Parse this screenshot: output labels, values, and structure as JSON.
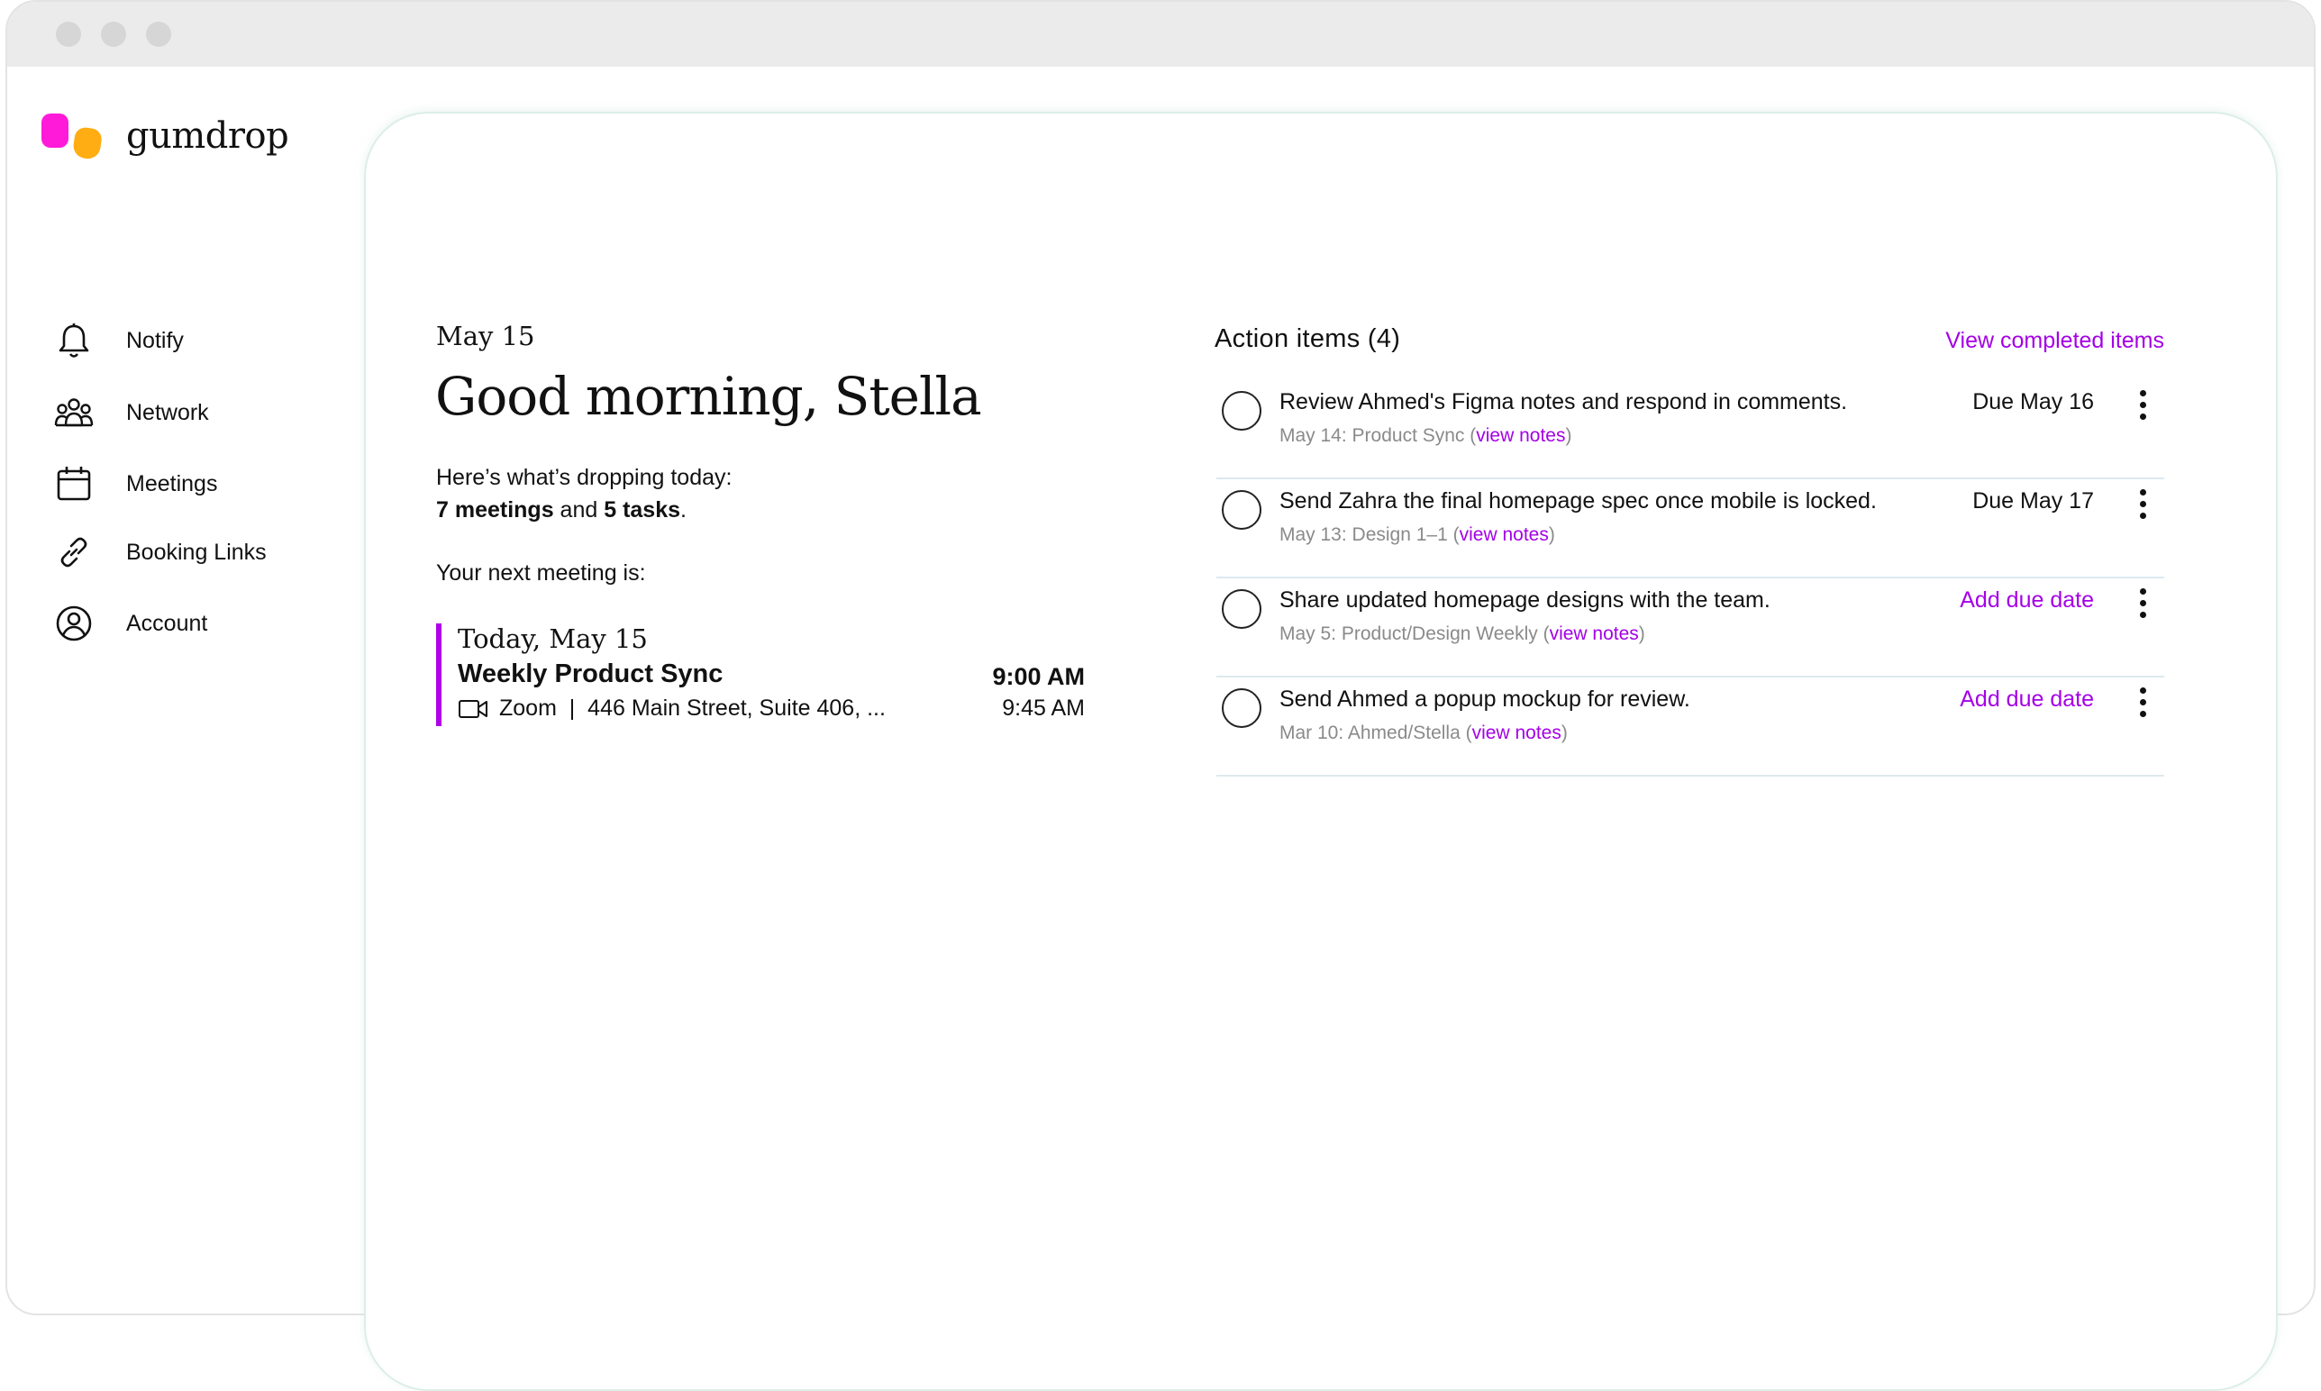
{
  "brand": {
    "name": "gumdrop",
    "colors": {
      "pink": "#ff1ad9",
      "orange": "#ffad12",
      "accent": "#a400e6"
    }
  },
  "sidebar": {
    "items": [
      {
        "label": "Notify",
        "icon": "bell-icon"
      },
      {
        "label": "Network",
        "icon": "people-icon"
      },
      {
        "label": "Meetings",
        "icon": "calendar-icon"
      },
      {
        "label": "Booking Links",
        "icon": "link-icon"
      },
      {
        "label": "Account",
        "icon": "user-circle-icon"
      }
    ]
  },
  "main": {
    "date": "May 15",
    "greeting": "Good morning, Stella",
    "dropping_intro": "Here’s what’s dropping today:",
    "meetings_count": "7 meetings",
    "and_text": " and ",
    "tasks_count": "5 tasks",
    "period": ".",
    "next_meeting_label": "Your next meeting is:",
    "next_meeting": {
      "date": "Today, May 15",
      "title": "Weekly Product Sync",
      "location": "Zoom  |  446 Main Street, Suite 406, ...",
      "start": "9:00 AM",
      "end": "9:45 AM"
    }
  },
  "action_items": {
    "title": "Action items (4)",
    "view_completed": "View completed items",
    "items": [
      {
        "task": "Review Ahmed's Figma notes and respond in comments.",
        "source": "May 14: Product Sync (",
        "link": "view notes",
        "close": ")",
        "due": "Due May 16"
      },
      {
        "task": "Send Zahra the final homepage spec once mobile is locked.",
        "source": "May 13: Design 1–1 (",
        "link": "view notes",
        "close": ")",
        "due": "Due May 17"
      },
      {
        "task": "Share updated homepage designs with the team.",
        "source": "May 5: Product/Design Weekly (",
        "link": "view notes",
        "close": ")",
        "due": "Add due date"
      },
      {
        "task": "Send Ahmed a popup mockup for review.",
        "source": "Mar 10: Ahmed/Stella (",
        "link": "view notes",
        "close": ")",
        "due": "Add due date"
      }
    ]
  }
}
